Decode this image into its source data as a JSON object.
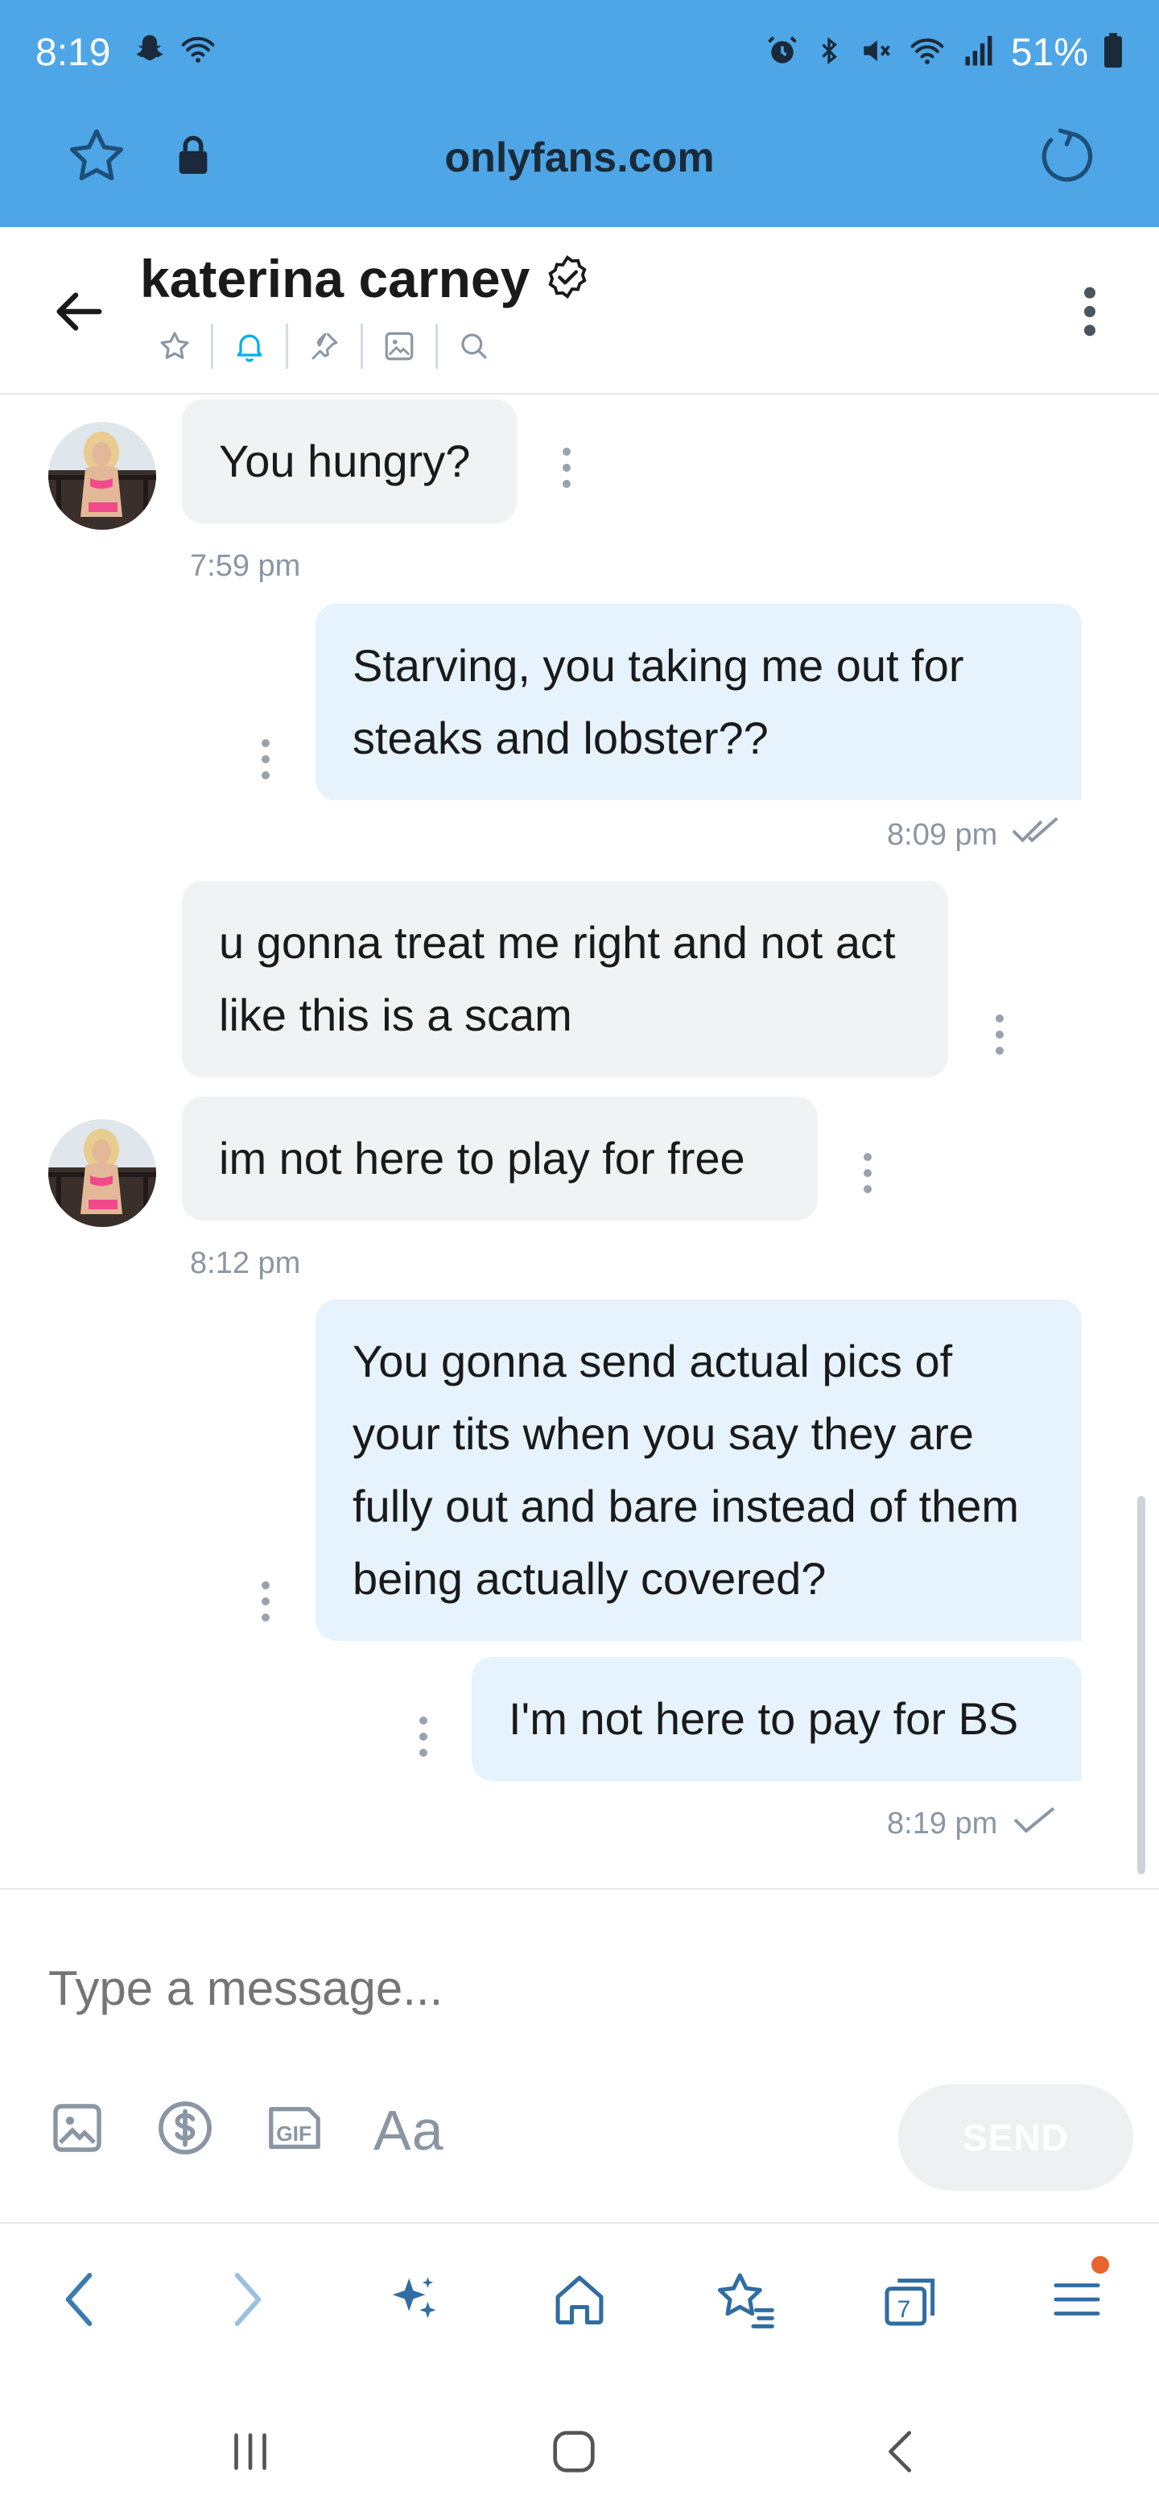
{
  "status_bar": {
    "time": "8:19",
    "battery": "51%"
  },
  "browser": {
    "url": "onlyfans.com"
  },
  "chat": {
    "name": "katerina carney",
    "verified": true
  },
  "messages": [
    {
      "from": "them",
      "text": "You hungry?",
      "time": "7:59 pm"
    },
    {
      "from": "me",
      "text": "Starving, you taking me out for steaks and lobster??",
      "time": "8:09 pm",
      "status": "read"
    },
    {
      "from": "them",
      "text": "u gonna treat me right and not act like this is a scam"
    },
    {
      "from": "them",
      "text": "im not here to play for free",
      "time": "8:12 pm"
    },
    {
      "from": "me",
      "text": "You gonna send actual pics of your tits when you say they are fully out and bare instead of them being actually covered?"
    },
    {
      "from": "me",
      "text": "I'm not here to pay for BS",
      "time": "8:19 pm",
      "status": "sent"
    }
  ],
  "compose": {
    "placeholder": "Type a message...",
    "text_tool_label": "Aa",
    "send_label": "SEND"
  },
  "bottom_nav": {
    "tabs_count": "7"
  },
  "colors": {
    "browser_bar": "#4ea6e6",
    "accent": "#00aff0",
    "incoming_bubble": "#f1f2f4",
    "outgoing_bubble": "#e6f3fd",
    "muted_text": "#8a96a3",
    "notification_dot": "#e8642c"
  }
}
